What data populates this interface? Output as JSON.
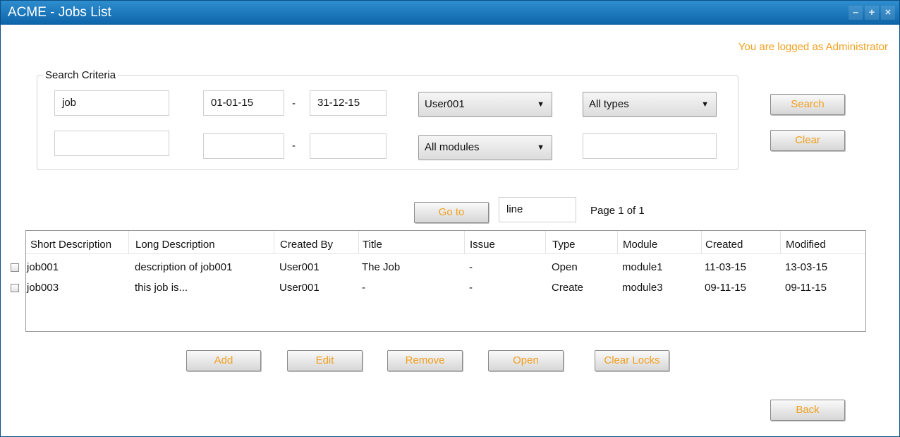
{
  "window": {
    "title": "ACME - Jobs List",
    "controls": [
      "minimize-icon",
      "maximize-icon",
      "close-icon"
    ]
  },
  "status": {
    "logged_text": "You are logged as Administrator"
  },
  "search": {
    "legend": "Search Criteria",
    "row1": {
      "text": "job",
      "date_from": "01-01-15",
      "date_to": "31-12-15",
      "user": "User001",
      "type": "All types"
    },
    "row2": {
      "text": "",
      "date_from": "",
      "date_to": "",
      "module": "All modules",
      "extra": ""
    },
    "dash": "-",
    "search_label": "Search",
    "clear_label": "Clear"
  },
  "pager": {
    "goto_label": "Go to",
    "goto_value": "line",
    "page_info": "Page 1 of 1"
  },
  "table": {
    "headers": [
      "Short Description",
      "Long Description",
      "Created By",
      "Title",
      "Issue",
      "Type",
      "Module",
      "Created",
      "Modified"
    ],
    "rows": [
      [
        "job001",
        "description of job001",
        "User001",
        "The Job",
        "-",
        "Open",
        "module1",
        "11-03-15",
        "13-03-15"
      ],
      [
        "job003",
        "this job is...",
        "User001",
        "-",
        "-",
        "Create",
        "module3",
        "09-11-15",
        "09-11-15"
      ]
    ]
  },
  "actions": {
    "add": "Add",
    "edit": "Edit",
    "remove": "Remove",
    "open": "Open",
    "clear_locks": "Clear Locks",
    "back": "Back"
  },
  "colors": {
    "titlebar": "#1a78bd",
    "accent": "#f0a020"
  }
}
